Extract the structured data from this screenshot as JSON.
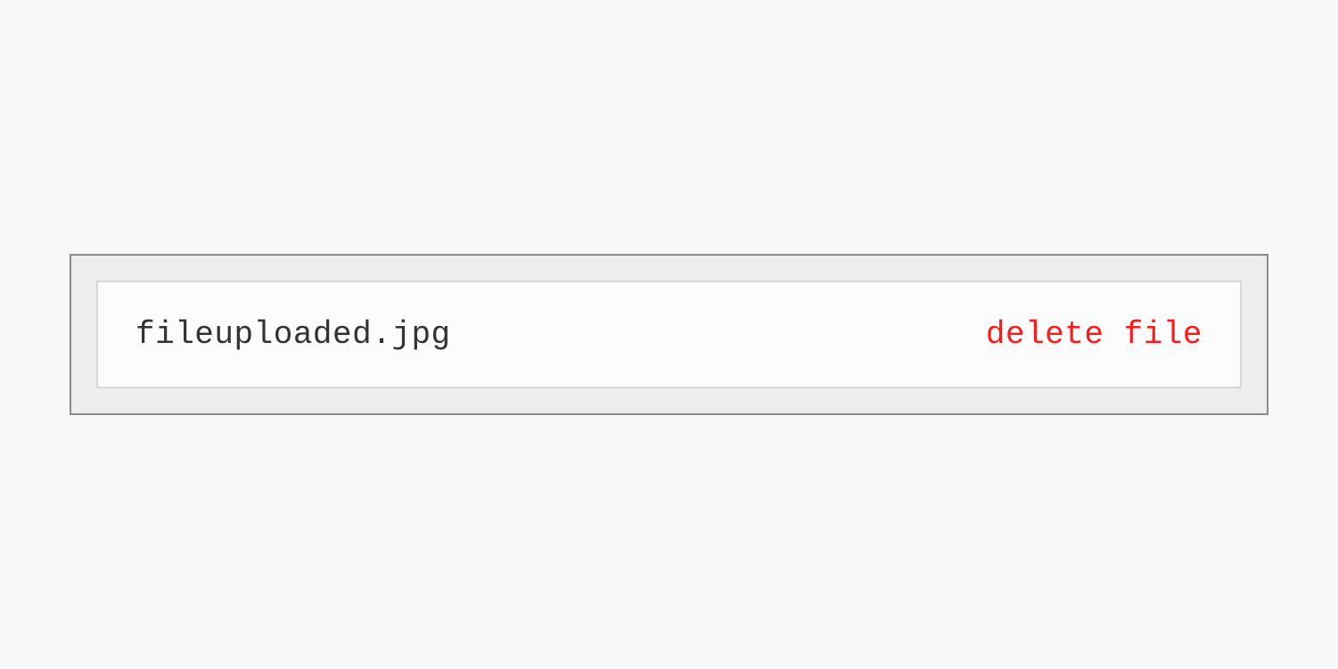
{
  "file": {
    "name": "fileuploaded.jpg",
    "delete_label": "delete file"
  }
}
